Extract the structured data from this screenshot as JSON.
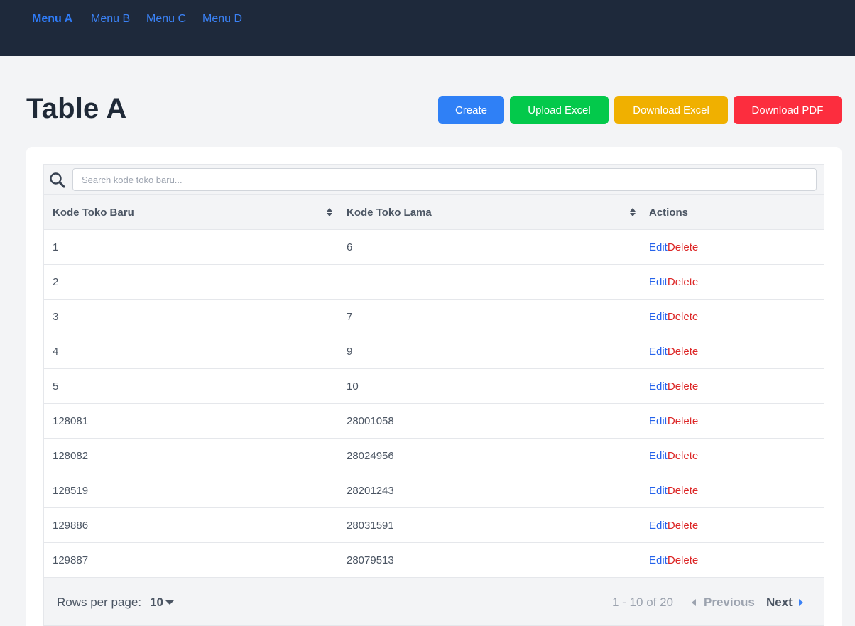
{
  "nav": {
    "items": [
      "Menu A",
      "Menu B",
      "Menu C",
      "Menu D"
    ],
    "active": "Menu A"
  },
  "page": {
    "title": "Table A"
  },
  "toolbar": {
    "create_label": "Create",
    "upload_excel_label": "Upload Excel",
    "download_excel_label": "Download Excel",
    "download_pdf_label": "Download PDF",
    "colors": {
      "create": "#2f80f6",
      "upload_excel": "#03c94b",
      "download_excel": "#f0b000",
      "download_pdf": "#fc2d3e"
    }
  },
  "search": {
    "placeholder": "Search kode toko baru..."
  },
  "table": {
    "columns": [
      "Kode Toko Baru",
      "Kode Toko Lama",
      "Actions"
    ],
    "action_labels": {
      "edit": "Edit",
      "delete": "Delete"
    },
    "rows": [
      [
        "1",
        "6"
      ],
      [
        "2",
        ""
      ],
      [
        "3",
        "7"
      ],
      [
        "4",
        "9"
      ],
      [
        "5",
        "10"
      ],
      [
        "128081",
        "28001058"
      ],
      [
        "128082",
        "28024956"
      ],
      [
        "128519",
        "28201243"
      ],
      [
        "129886",
        "28031591"
      ],
      [
        "129887",
        "28079513"
      ]
    ]
  },
  "pagination": {
    "rows_per_page_label": "Rows per page:",
    "rows_per_page_value": "10",
    "range_text": "1 - 10 of 20",
    "previous_label": "Previous",
    "next_label": "Next"
  }
}
